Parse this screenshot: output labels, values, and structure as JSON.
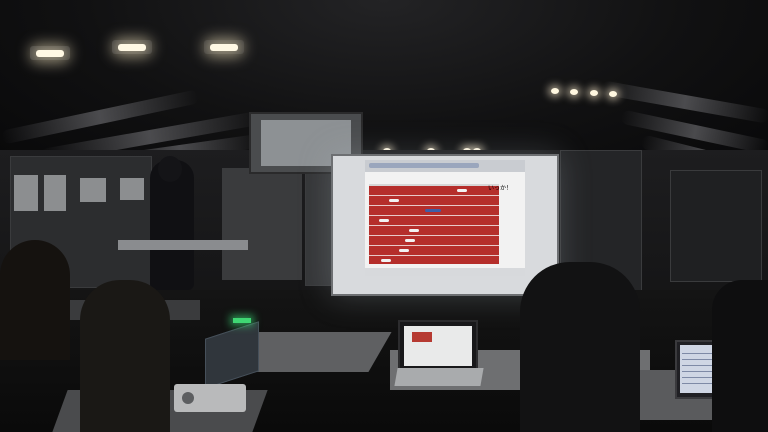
{
  "scene": {
    "description_ref": "presentation-room",
    "projection": {
      "shout_text": "いっか！",
      "status_text": "",
      "track_color": "#b52e2b",
      "runner_colors": [
        "#f2f2f2",
        "#f2f2f2",
        "#3d5fa8",
        "#f2f2f2",
        "#f2f2f2",
        "#f2f2f2",
        "#f2f2f2",
        "#f2f2f2"
      ]
    },
    "laptop_center": {
      "accent": "#b63a32"
    },
    "exit_light_color": "#3fd673"
  }
}
